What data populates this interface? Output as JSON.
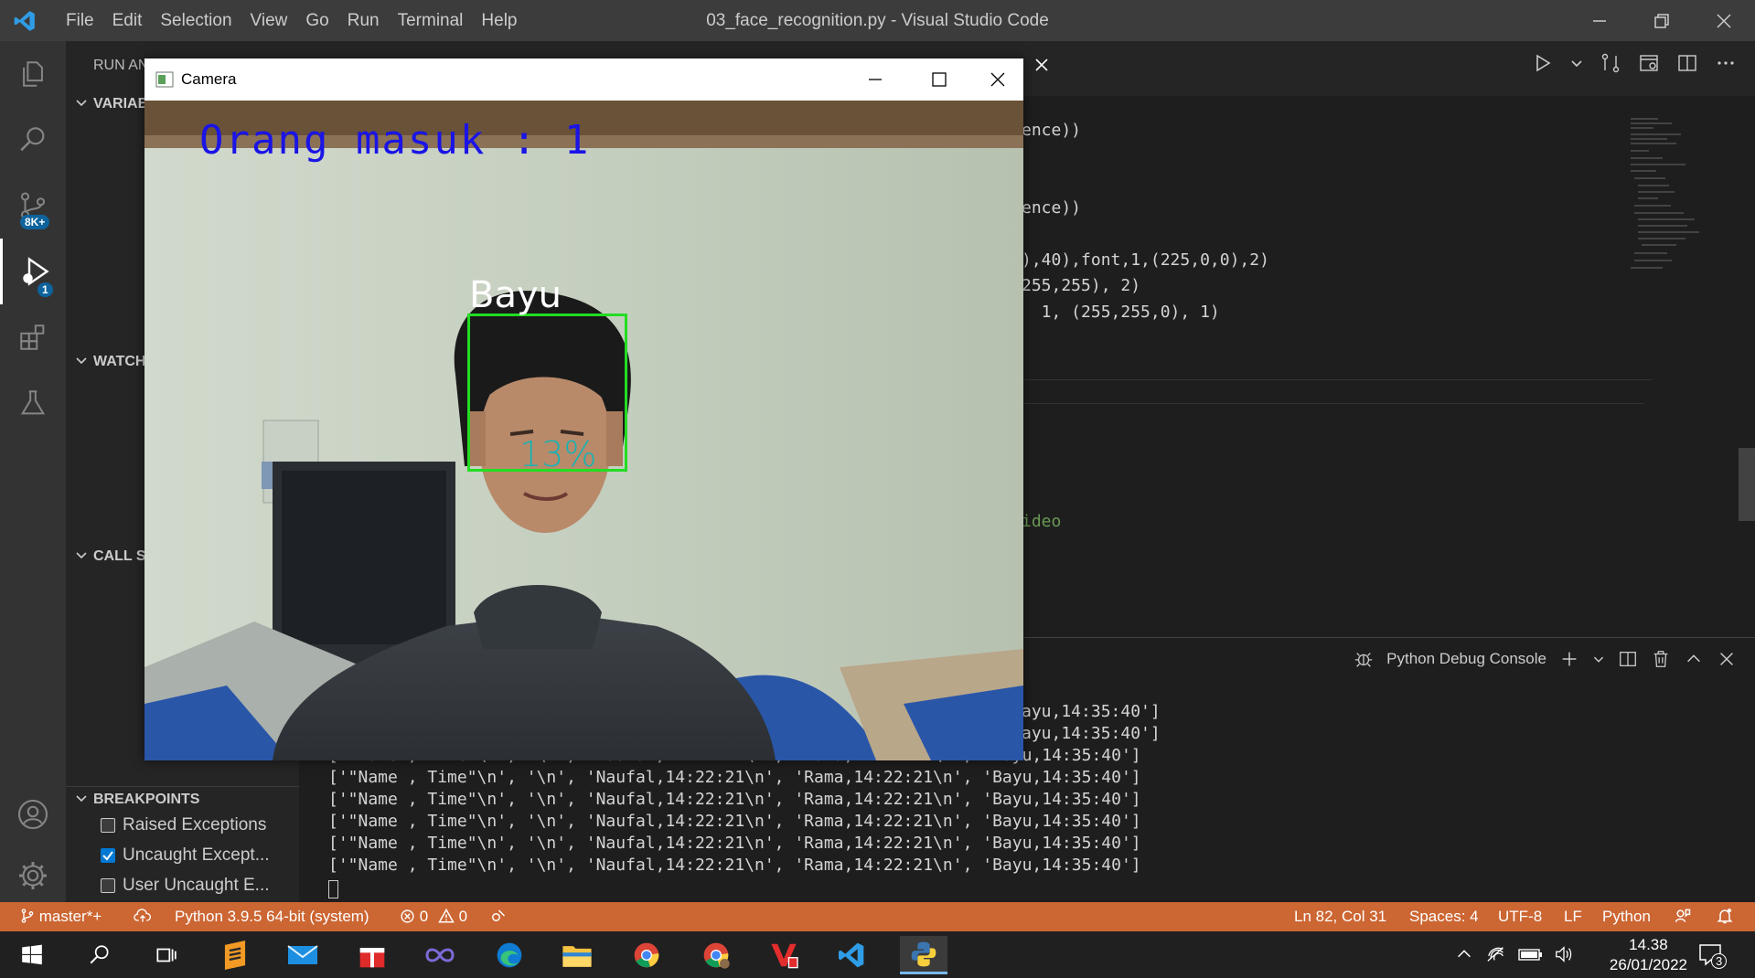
{
  "titlebar": {
    "menu": [
      "File",
      "Edit",
      "Selection",
      "View",
      "Go",
      "Run",
      "Terminal",
      "Help"
    ],
    "window_title": "03_face_recognition.py - Visual Studio Code"
  },
  "activity": {
    "scm_badge": "8K+",
    "debug_badge": "1"
  },
  "sidebar": {
    "header": "RUN AN",
    "sections": {
      "variables": "VARIAB",
      "watch": "WATCH",
      "callstack": "CALL ST",
      "breakpoints": "BREAKPOINTS"
    },
    "breakpoints": [
      {
        "label": "Raised Exceptions",
        "checked": false
      },
      {
        "label": "Uncaught Except...",
        "checked": true
      },
      {
        "label": "User Uncaught E...",
        "checked": false
      }
    ]
  },
  "editor": {
    "lines": [
      "ence))",
      "ence))",
      "),40),font,1,(225,0,0),2)",
      "255,255), 2)",
      "  1, (255,255,0), 1)",
      "ideo"
    ]
  },
  "panel": {
    "console_label": "Python Debug Console",
    "partial_lines": [
      "ayu,14:35:40']",
      "ayu,14:35:40']"
    ],
    "cut_line": "['\"Name , Time\"\\n', '\\n', 'Naufal,14:22:21\\n', 'Rama,14:22:21\\n', 'Bayu,14:35:40']",
    "lines": [
      "['\"Name , Time\"\\n', '\\n', 'Naufal,14:22:21\\n', 'Rama,14:22:21\\n', 'Bayu,14:35:40']",
      "['\"Name , Time\"\\n', '\\n', 'Naufal,14:22:21\\n', 'Rama,14:22:21\\n', 'Bayu,14:35:40']",
      "['\"Name , Time\"\\n', '\\n', 'Naufal,14:22:21\\n', 'Rama,14:22:21\\n', 'Bayu,14:35:40']",
      "['\"Name , Time\"\\n', '\\n', 'Naufal,14:22:21\\n', 'Rama,14:22:21\\n', 'Bayu,14:35:40']",
      "['\"Name , Time\"\\n', '\\n', 'Naufal,14:22:21\\n', 'Rama,14:22:21\\n', 'Bayu,14:35:40']"
    ]
  },
  "statusbar": {
    "branch": "master*+",
    "interpreter": "Python 3.9.5 64-bit (system)",
    "errors": "0",
    "warnings": "0",
    "position": "Ln 82, Col 31",
    "spaces": "Spaces: 4",
    "encoding": "UTF-8",
    "eol": "LF",
    "language": "Python"
  },
  "camera": {
    "title": "Camera",
    "overlay_count": "Orang masuk : 1",
    "face_name": "Bayu",
    "confidence": "13%"
  },
  "taskbar": {
    "time": "14.38",
    "date": "26/01/2022",
    "notification_count": "3"
  },
  "colors": {
    "statusbar": "#cc6633",
    "accent": "#0078d4",
    "face_box": "#22dd22",
    "overlay_text": "#1a14e6"
  }
}
